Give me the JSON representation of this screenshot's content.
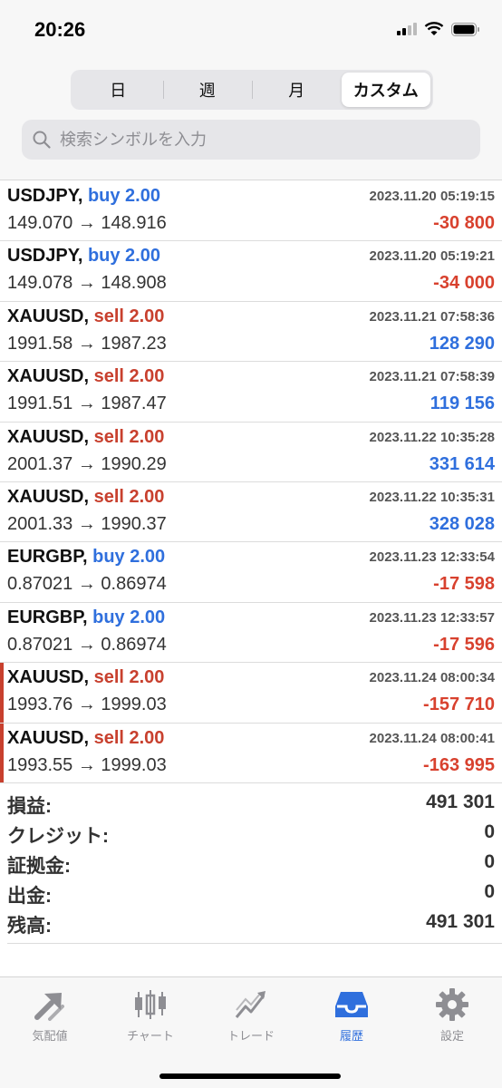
{
  "status": {
    "time": "20:26"
  },
  "segments": [
    {
      "label": "日"
    },
    {
      "label": "週"
    },
    {
      "label": "月"
    },
    {
      "label": "カスタム"
    }
  ],
  "search": {
    "placeholder": "検索シンボルを入力"
  },
  "trades": [
    {
      "symbol": "USDJPY,",
      "side": "buy 2.00",
      "date": "2023.11.20 05:19:15",
      "prices": "149.070 → 148.916",
      "pnl": "-30 800"
    },
    {
      "symbol": "USDJPY,",
      "side": "buy 2.00",
      "date": "2023.11.20 05:19:21",
      "prices": "149.078 → 148.908",
      "pnl": "-34 000"
    },
    {
      "symbol": "XAUUSD,",
      "side": "sell 2.00",
      "date": "2023.11.21 07:58:36",
      "prices": "1991.58 → 1987.23",
      "pnl": "128 290"
    },
    {
      "symbol": "XAUUSD,",
      "side": "sell 2.00",
      "date": "2023.11.21 07:58:39",
      "prices": "1991.51 → 1987.47",
      "pnl": "119 156"
    },
    {
      "symbol": "XAUUSD,",
      "side": "sell 2.00",
      "date": "2023.11.22 10:35:28",
      "prices": "2001.37 → 1990.29",
      "pnl": "331 614"
    },
    {
      "symbol": "XAUUSD,",
      "side": "sell 2.00",
      "date": "2023.11.22 10:35:31",
      "prices": "2001.33 → 1990.37",
      "pnl": "328 028"
    },
    {
      "symbol": "EURGBP,",
      "side": "buy 2.00",
      "date": "2023.11.23 12:33:54",
      "prices": "0.87021 → 0.86974",
      "pnl": "-17 598"
    },
    {
      "symbol": "EURGBP,",
      "side": "buy 2.00",
      "date": "2023.11.23 12:33:57",
      "prices": "0.87021 → 0.86974",
      "pnl": "-17 596"
    },
    {
      "symbol": "XAUUSD,",
      "side": "sell 2.00",
      "date": "2023.11.24 08:00:34",
      "prices": "1993.76 → 1999.03",
      "pnl": "-157 710"
    },
    {
      "symbol": "XAUUSD,",
      "side": "sell 2.00",
      "date": "2023.11.24 08:00:41",
      "prices": "1993.55 → 1999.03",
      "pnl": "-163 995"
    }
  ],
  "summary": [
    {
      "label": "損益:",
      "value": "491 301"
    },
    {
      "label": "クレジット:",
      "value": "0"
    },
    {
      "label": "証拠金:",
      "value": "0"
    },
    {
      "label": "出金:",
      "value": "0"
    },
    {
      "label": "残高:",
      "value": "491 301"
    }
  ],
  "tabs": [
    {
      "label": "気配値",
      "icon": "quotes-arrows-icon"
    },
    {
      "label": "チャート",
      "icon": "candlestick-chart-icon"
    },
    {
      "label": "トレード",
      "icon": "trade-chart-icon"
    },
    {
      "label": "履歴",
      "icon": "history-tray-icon"
    },
    {
      "label": "設定",
      "icon": "gear-icon"
    }
  ],
  "colors": {
    "buy": "#2f6fdd",
    "sell": "#c8402e",
    "profit": "#2f6fdd",
    "loss": "#d8412e",
    "active_tab": "#2f6fdd"
  }
}
